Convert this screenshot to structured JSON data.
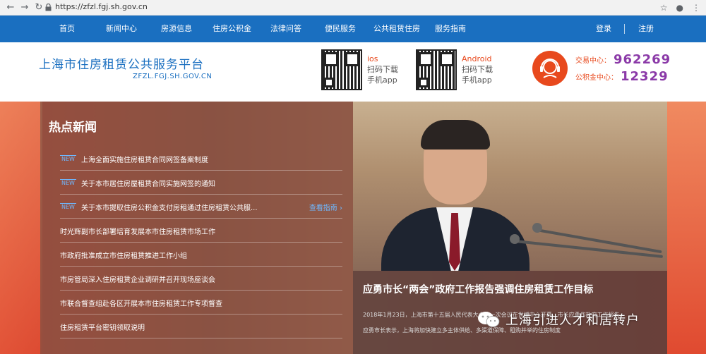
{
  "browser": {
    "url": "https://zfzl.fgj.sh.gov.cn",
    "icons": [
      "back-icon",
      "forward-icon",
      "reload-icon",
      "lock-icon",
      "star-icon",
      "account-icon",
      "menu-icon"
    ]
  },
  "nav": {
    "items": [
      "首页",
      "新闻中心",
      "房源信息",
      "住房公积金",
      "法律问答",
      "便民服务",
      "公共租赁住房",
      "服务指南"
    ],
    "login": "登录",
    "register": "注册"
  },
  "header": {
    "title": "上海市住房租赁公共服务平台",
    "domain": "ZFZL.FGJ.SH.GOV.CN",
    "apps": [
      {
        "os": "ios",
        "line1": "扫码下载",
        "line2": "手机app"
      },
      {
        "os": "Android",
        "line1": "扫码下载",
        "line2": "手机app"
      }
    ],
    "hotlines": [
      {
        "label": "交易中心：",
        "number": "962269"
      },
      {
        "label": "公积金中心：",
        "number": "12329"
      }
    ]
  },
  "news": {
    "title": "热点新闻",
    "tag": "NEW",
    "more": "查看指南",
    "items": [
      "上海全面实施住房租赁合同网签备案制度",
      "关于本市居住房屋租赁合同实施网签的通知",
      "关于本市提取住房公积金支付房租通过住房租赁公共服...",
      "时光辉副市长部署培育发展本市住房租赁市场工作",
      "市政府批准成立市住房租赁推进工作小组",
      "市房管局深入住房租赁企业调研并召开现场座谈会",
      "市联合督查组赴各区开展本市住房租赁工作专项督查",
      "住房租赁平台密钥领取说明"
    ]
  },
  "feature": {
    "title": "应勇市长“两会”政府工作报告强调住房租赁工作目标",
    "body_line1": "2018年1月23日，上海市第十五届人民代表大会第一次会议在世博中心开幕，市长应勇作政府工作报告",
    "body_line2": "应勇市长表示，上海将加快建立多主体供给、多渠道保障、租购并举的住房制度"
  },
  "watermark": "上海引进人才和居转户"
}
